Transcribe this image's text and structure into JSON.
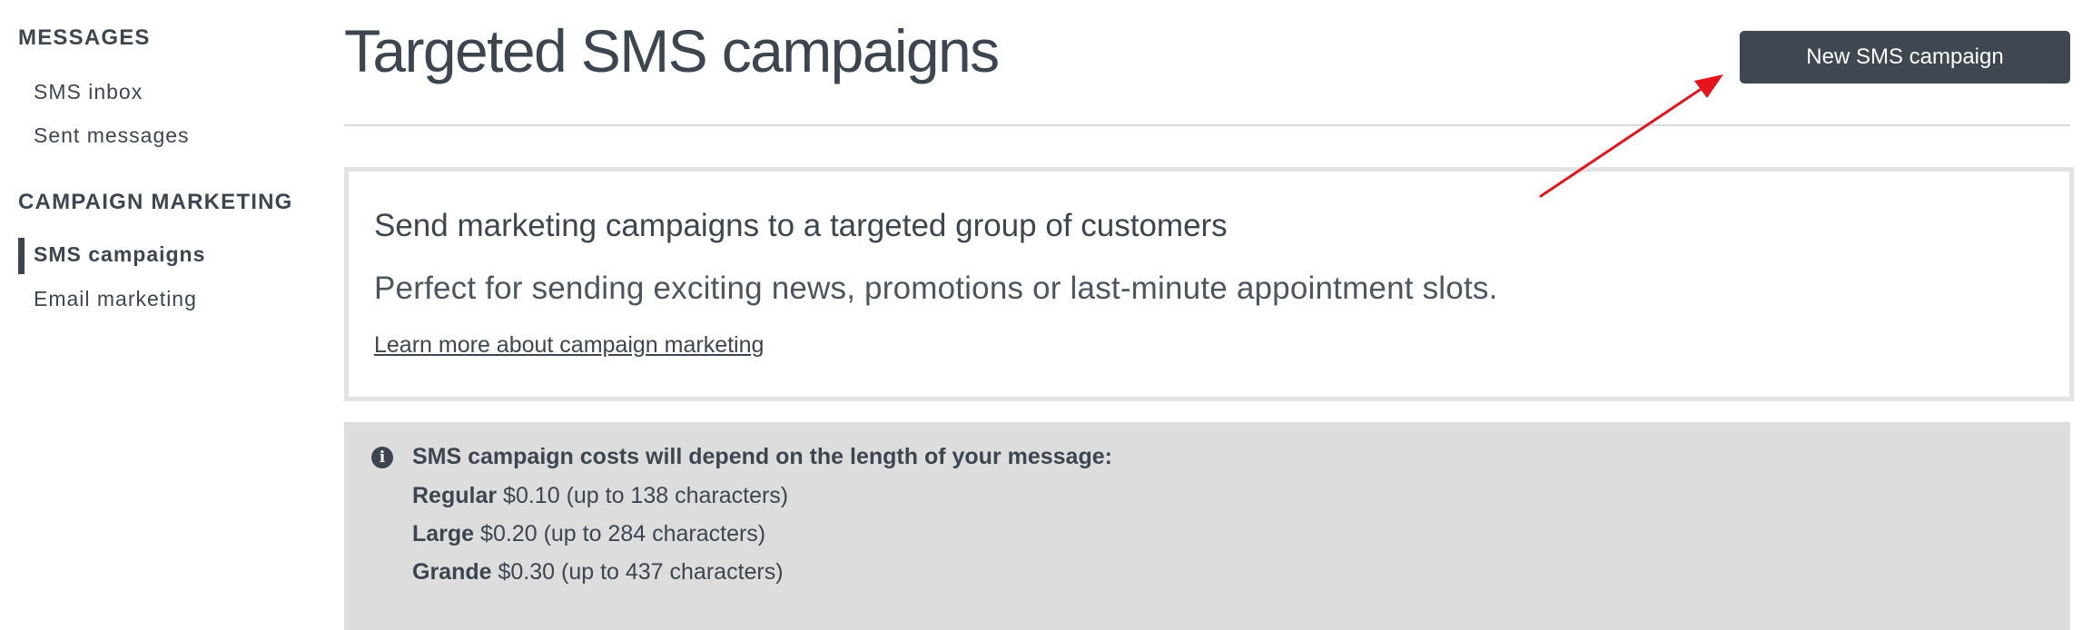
{
  "sidebar": {
    "sections": [
      {
        "heading": "MESSAGES",
        "items": [
          {
            "label": "SMS inbox",
            "active": false
          },
          {
            "label": "Sent messages",
            "active": false
          }
        ]
      },
      {
        "heading": "CAMPAIGN MARKETING",
        "items": [
          {
            "label": "SMS campaigns",
            "active": true
          },
          {
            "label": "Email marketing",
            "active": false
          }
        ]
      }
    ]
  },
  "header": {
    "title": "Targeted SMS campaigns",
    "new_button_label": "New SMS campaign"
  },
  "promo": {
    "title": "Send marketing campaigns to a targeted group of customers",
    "text": "Perfect for sending exciting news, promotions or last-minute appointment slots.",
    "link_label": "Learn more about campaign marketing"
  },
  "info": {
    "icon": "info-icon",
    "heading": "SMS campaign costs will depend on the length of your message:",
    "tiers": [
      {
        "name": "Regular",
        "price": "$0.10",
        "detail": "(up to 138 characters)"
      },
      {
        "name": "Large",
        "price": "$0.20",
        "detail": "(up to 284 characters)"
      },
      {
        "name": "Grande",
        "price": "$0.30",
        "detail": "(up to 437 characters)"
      }
    ]
  },
  "colors": {
    "text": "#3d464f",
    "button_bg": "#3f4850",
    "info_bg": "#dddddd",
    "promo_border": "#e3e3e3",
    "annotation_arrow": "#e8141c"
  }
}
